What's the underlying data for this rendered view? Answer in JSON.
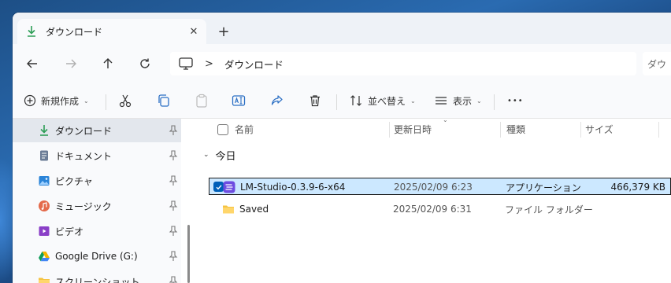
{
  "window": {
    "tab_title": "ダウンロード",
    "close_glyph": "✕",
    "new_tab_glyph": "+"
  },
  "address": {
    "path_segments": [
      "ダウンロード"
    ],
    "search_placeholder": "ダウ"
  },
  "toolbar": {
    "new_label": "新規作成",
    "sort_label": "並べ替え",
    "view_label": "表示",
    "more_glyph": "•••",
    "chevron": "⌄"
  },
  "sidebar": {
    "items": [
      {
        "label": "ダウンロード",
        "icon": "download-icon",
        "selected": true,
        "pinned": true
      },
      {
        "label": "ドキュメント",
        "icon": "document-icon",
        "pinned": true
      },
      {
        "label": "ピクチャ",
        "icon": "pictures-icon",
        "pinned": true
      },
      {
        "label": "ミュージック",
        "icon": "music-icon",
        "pinned": true
      },
      {
        "label": "ビデオ",
        "icon": "video-icon",
        "pinned": true
      },
      {
        "label": "Google Drive (G:)",
        "icon": "google-drive-icon",
        "pinned": true
      },
      {
        "label": "スクリーンショット",
        "icon": "folder-icon",
        "pinned": true
      }
    ]
  },
  "columns": {
    "name": "名前",
    "modified": "更新日時",
    "type": "種類",
    "size": "サイズ"
  },
  "group": {
    "label": "今日",
    "chevron": "⌄"
  },
  "files": [
    {
      "name": "LM-Studio-0.3.9-6-x64",
      "modified": "2025/02/09 6:23",
      "type": "アプリケーション",
      "size": "466,379 KB",
      "icon": "lm-studio-icon",
      "selected": true
    },
    {
      "name": "Saved",
      "modified": "2025/02/09 6:31",
      "type": "ファイル フォルダー",
      "size": "",
      "icon": "folder-icon",
      "selected": false
    }
  ],
  "colors": {
    "accent": "#005fb8",
    "selection": "#cce8ff",
    "download_green": "#2e9e57",
    "folder_yellow": "#f5c342"
  }
}
